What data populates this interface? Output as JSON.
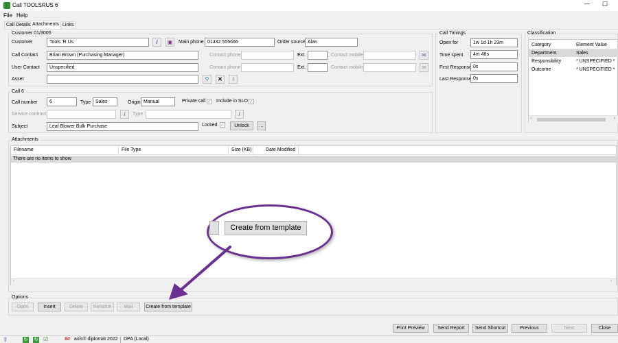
{
  "window": {
    "title": "Call TOOLSRUS 6",
    "minimize": "—",
    "maximize": "☐"
  },
  "menu": {
    "file": "File",
    "help": "Help"
  },
  "tabs": [
    "Call Details",
    "Attachments",
    "Links"
  ],
  "customer_group": {
    "title": "Customer 01/3005",
    "customer_label": "Customer",
    "customer_value": "Tools 'R Us",
    "main_phone_label": "Main phone",
    "main_phone_value": "01432 555666",
    "order_source_label": "Order source",
    "order_source_value": "Alan",
    "call_contact_label": "Call Contact",
    "call_contact_value": "Brian Brown (Purchasing Manager)",
    "contact_phone_label": "Contact phone",
    "contact_phone_label2": "Contact phone",
    "ext_label": "Ext.",
    "ext_label2": "Ext.",
    "contact_mobile_label": "Contact mobile",
    "contact_mobile_label2": "Contact mobile",
    "user_contact_label": "User Contact",
    "user_contact_value": "Unspecified",
    "asset_label": "Asset"
  },
  "call_group": {
    "title": "Call 6",
    "call_number_label": "Call number",
    "call_number_value": "6",
    "type_label": "Type",
    "type_value": "Sales",
    "origin_label": "Origin",
    "origin_value": "Manual",
    "private_call_label": "Private call",
    "include_slo_label": "Include in SLO",
    "service_contract_label": "Service contract",
    "type2_label": "Type",
    "subject_label": "Subject",
    "subject_value": "Leaf Blower Bulk Purchase",
    "locked_label": "Locked",
    "unlock_button": "Unlock",
    "more_button": "..."
  },
  "timings": {
    "title": "Call Timings",
    "open_for_label": "Open for",
    "open_for_value": "1w 1d 1h 23m",
    "time_spent_label": "Time spent",
    "time_spent_value": "4m 48s",
    "first_response_label": "First Response",
    "first_response_value": "0s",
    "last_response_label": "Last Response",
    "last_response_value": "0s"
  },
  "classification": {
    "title": "Classification",
    "col_category": "Category",
    "col_value": "Element Value",
    "rows": [
      {
        "category": "Department",
        "value": "Sales"
      },
      {
        "category": "Responsibility",
        "value": "* UNSPECIFIED *"
      },
      {
        "category": "Outcome",
        "value": "* UNSPECIFIED *"
      }
    ]
  },
  "attachments": {
    "title": "Attachments",
    "columns": [
      "Filename",
      "File Type",
      "Size (KB)",
      "Date Modified"
    ],
    "empty_text": "There are no items to show"
  },
  "options": {
    "title": "Options",
    "open": "Open",
    "insert": "Insert",
    "delete": "Delete",
    "rename": "Rename",
    "mail": "Mail",
    "create_from_template": "Create from template"
  },
  "callout": {
    "button_label": "Create from template"
  },
  "bottom_buttons": {
    "print_preview": "Print Preview",
    "send_report": "Send Report",
    "send_shortcut": "Send Shortcut",
    "previous": "Previous",
    "next": "Next",
    "close": "Close"
  },
  "taskbar": {
    "app_name": "axis® diplomat 2022",
    "dpa": "DPA (Local)"
  },
  "colors": {
    "callout_ring": "#6a2f8f",
    "selected_row": "#d9d9d9"
  }
}
